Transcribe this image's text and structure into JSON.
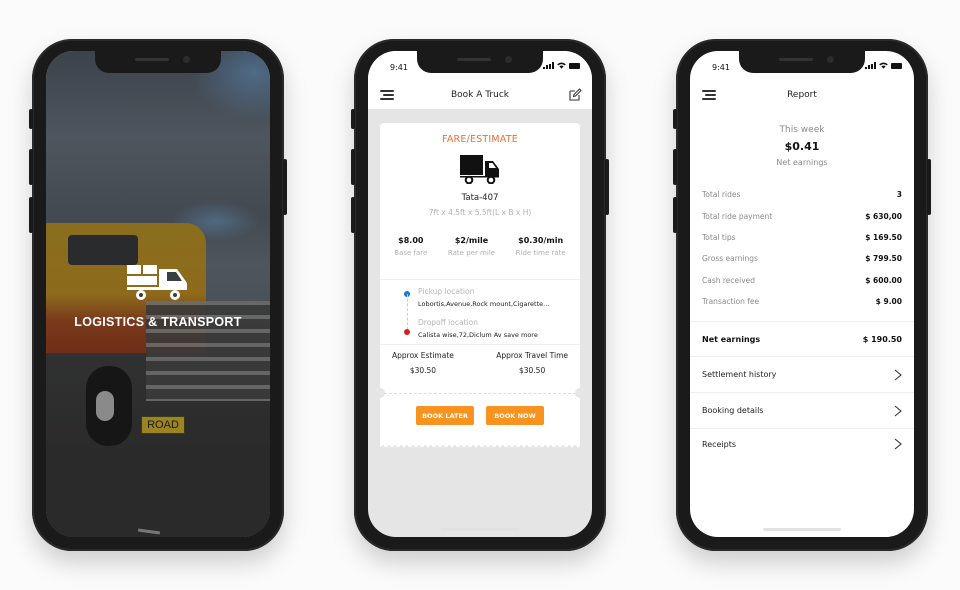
{
  "status_bar": {
    "time": "9:41"
  },
  "splash": {
    "title": "LOGISTICS & TRANSPORT",
    "logo_icon": "delivery-truck-icon",
    "background": "truck-photo",
    "road_sign_text": "ROAD"
  },
  "booking": {
    "header": {
      "title": "Book A Truck",
      "menu_icon": "hamburger-menu-icon",
      "edit_icon": "edit-icon"
    },
    "card": {
      "section_title": "FARE/ESTIMATE",
      "truck_icon": "truck-icon",
      "truck_name": "Tata-407",
      "dimensions": "7ft x 4.5ft x 5.5ft(L x B x H)",
      "rates": [
        {
          "value": "$8.00",
          "label": "Base fare"
        },
        {
          "value": "$2/mile",
          "label": "Rate per mile"
        },
        {
          "value": "$0.30/min",
          "label": "Ride time rate"
        }
      ],
      "pickup": {
        "label": "Pickup location",
        "address": "Lobortis,Avenue,Rock mount,Cigarette..."
      },
      "dropoff": {
        "label": "Dropoff location",
        "address": "Calista wise,72,Diclum Av save more"
      },
      "estimates": [
        {
          "label": "Approx Estimate",
          "value": "$30.50"
        },
        {
          "label": "Approx Travel Time",
          "value": "$30.50"
        }
      ],
      "buttons": {
        "book_later": "BOOK LATER",
        "book_now": "BOOK NOW"
      }
    },
    "colors": {
      "accent": "#e8713a",
      "button": "#f7931e",
      "pickup_dot": "#1a73e8",
      "dropoff_dot": "#d6201f"
    }
  },
  "report": {
    "header": {
      "title": "Report",
      "menu_icon": "hamburger-menu-icon"
    },
    "summary": {
      "period": "This week",
      "amount": "$0.41",
      "caption": "Net earnings"
    },
    "stats": [
      {
        "label": "Total rides",
        "value": "3"
      },
      {
        "label": "Total ride payment",
        "value": "$ 630,00"
      },
      {
        "label": "Total tips",
        "value": "$ 169.50"
      },
      {
        "label": "Gross earnings",
        "value": "$ 799.50"
      },
      {
        "label": "Cash received",
        "value": "$ 600.00"
      },
      {
        "label": "Transaction fee",
        "value": "$ 9.00"
      }
    ],
    "net": {
      "label": "Net earnings",
      "value": "$ 190.50"
    },
    "links": [
      {
        "label": "Settlement history",
        "icon": "chevron-right-icon"
      },
      {
        "label": "Booking details",
        "icon": "chevron-right-icon"
      },
      {
        "label": "Receipts",
        "icon": "chevron-right-icon"
      }
    ]
  }
}
